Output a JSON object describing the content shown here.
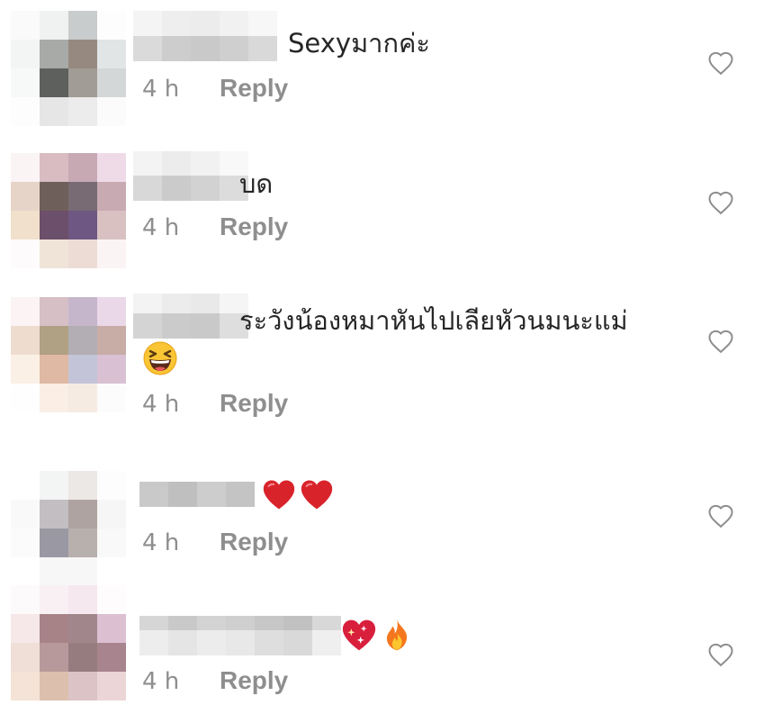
{
  "comments": [
    {
      "text": "Sexyมากค่ะ",
      "time": "4 h",
      "reply": "Reply",
      "emojis": []
    },
    {
      "text": "บด",
      "time": "4 h",
      "reply": "Reply",
      "emojis": []
    },
    {
      "text": "ระวังน้องหมาหันไปเลียหัวนมนะแม่",
      "time": "4 h",
      "reply": "Reply",
      "emojis": [
        "laughing-face"
      ]
    },
    {
      "text": "",
      "time": "4 h",
      "reply": "Reply",
      "emojis": [
        "red-heart",
        "red-heart"
      ]
    },
    {
      "text": "",
      "time": "4 h",
      "reply": "Reply",
      "emojis": [
        "sparkling-heart",
        "fire"
      ]
    }
  ],
  "colors": {
    "meta_gray": "#8e8e8e",
    "text": "#262626",
    "heart_outline": "#8e8e8e"
  }
}
